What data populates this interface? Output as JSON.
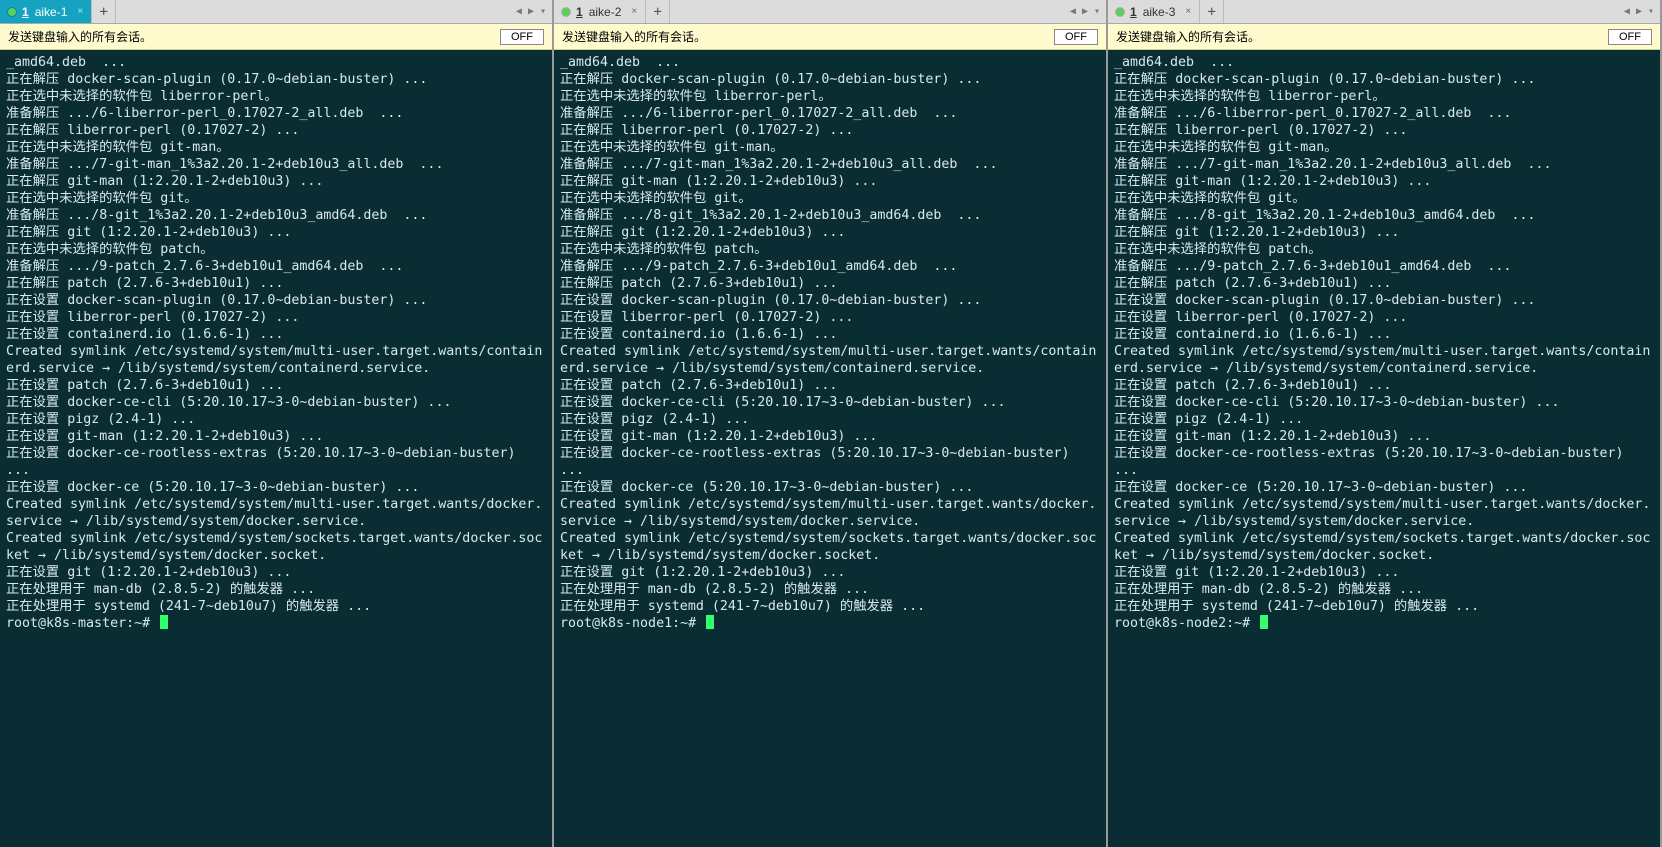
{
  "panes": [
    {
      "tab": {
        "index": "1",
        "title": "aike-1",
        "active": true
      },
      "infobar": {
        "message": "发送键盘输入的所有会话。",
        "button": "OFF"
      },
      "prompt": "root@k8s-master:~# ",
      "lines": [
        "_amd64.deb  ...",
        "正在解压 docker-scan-plugin (0.17.0~debian-buster) ...",
        "正在选中未选择的软件包 liberror-perl。",
        "准备解压 .../6-liberror-perl_0.17027-2_all.deb  ...",
        "正在解压 liberror-perl (0.17027-2) ...",
        "正在选中未选择的软件包 git-man。",
        "准备解压 .../7-git-man_1%3a2.20.1-2+deb10u3_all.deb  ...",
        "正在解压 git-man (1:2.20.1-2+deb10u3) ...",
        "正在选中未选择的软件包 git。",
        "准备解压 .../8-git_1%3a2.20.1-2+deb10u3_amd64.deb  ...",
        "正在解压 git (1:2.20.1-2+deb10u3) ...",
        "正在选中未选择的软件包 patch。",
        "准备解压 .../9-patch_2.7.6-3+deb10u1_amd64.deb  ...",
        "正在解压 patch (2.7.6-3+deb10u1) ...",
        "正在设置 docker-scan-plugin (0.17.0~debian-buster) ...",
        "正在设置 liberror-perl (0.17027-2) ...",
        "正在设置 containerd.io (1.6.6-1) ...",
        "Created symlink /etc/systemd/system/multi-user.target.wants/containerd.service → /lib/systemd/system/containerd.service.",
        "正在设置 patch (2.7.6-3+deb10u1) ...",
        "正在设置 docker-ce-cli (5:20.10.17~3-0~debian-buster) ...",
        "正在设置 pigz (2.4-1) ...",
        "正在设置 git-man (1:2.20.1-2+deb10u3) ...",
        "正在设置 docker-ce-rootless-extras (5:20.10.17~3-0~debian-buster) ...",
        "正在设置 docker-ce (5:20.10.17~3-0~debian-buster) ...",
        "Created symlink /etc/systemd/system/multi-user.target.wants/docker.service → /lib/systemd/system/docker.service.",
        "Created symlink /etc/systemd/system/sockets.target.wants/docker.socket → /lib/systemd/system/docker.socket.",
        "正在设置 git (1:2.20.1-2+deb10u3) ...",
        "正在处理用于 man-db (2.8.5-2) 的触发器 ...",
        "正在处理用于 systemd (241-7~deb10u7) 的触发器 ..."
      ]
    },
    {
      "tab": {
        "index": "1",
        "title": "aike-2",
        "active": false
      },
      "infobar": {
        "message": "发送键盘输入的所有会话。",
        "button": "OFF"
      },
      "prompt": "root@k8s-node1:~# ",
      "lines": [
        "_amd64.deb  ...",
        "正在解压 docker-scan-plugin (0.17.0~debian-buster) ...",
        "正在选中未选择的软件包 liberror-perl。",
        "准备解压 .../6-liberror-perl_0.17027-2_all.deb  ...",
        "正在解压 liberror-perl (0.17027-2) ...",
        "正在选中未选择的软件包 git-man。",
        "准备解压 .../7-git-man_1%3a2.20.1-2+deb10u3_all.deb  ...",
        "正在解压 git-man (1:2.20.1-2+deb10u3) ...",
        "正在选中未选择的软件包 git。",
        "准备解压 .../8-git_1%3a2.20.1-2+deb10u3_amd64.deb  ...",
        "正在解压 git (1:2.20.1-2+deb10u3) ...",
        "正在选中未选择的软件包 patch。",
        "准备解压 .../9-patch_2.7.6-3+deb10u1_amd64.deb  ...",
        "正在解压 patch (2.7.6-3+deb10u1) ...",
        "正在设置 docker-scan-plugin (0.17.0~debian-buster) ...",
        "正在设置 liberror-perl (0.17027-2) ...",
        "正在设置 containerd.io (1.6.6-1) ...",
        "Created symlink /etc/systemd/system/multi-user.target.wants/containerd.service → /lib/systemd/system/containerd.service.",
        "正在设置 patch (2.7.6-3+deb10u1) ...",
        "正在设置 docker-ce-cli (5:20.10.17~3-0~debian-buster) ...",
        "正在设置 pigz (2.4-1) ...",
        "正在设置 git-man (1:2.20.1-2+deb10u3) ...",
        "正在设置 docker-ce-rootless-extras (5:20.10.17~3-0~debian-buster) ...",
        "正在设置 docker-ce (5:20.10.17~3-0~debian-buster) ...",
        "Created symlink /etc/systemd/system/multi-user.target.wants/docker.service → /lib/systemd/system/docker.service.",
        "Created symlink /etc/systemd/system/sockets.target.wants/docker.socket → /lib/systemd/system/docker.socket.",
        "正在设置 git (1:2.20.1-2+deb10u3) ...",
        "正在处理用于 man-db (2.8.5-2) 的触发器 ...",
        "正在处理用于 systemd (241-7~deb10u7) 的触发器 ..."
      ]
    },
    {
      "tab": {
        "index": "1",
        "title": "aike-3",
        "active": false
      },
      "infobar": {
        "message": "发送键盘输入的所有会话。",
        "button": "OFF"
      },
      "prompt": "root@k8s-node2:~# ",
      "lines": [
        "_amd64.deb  ...",
        "正在解压 docker-scan-plugin (0.17.0~debian-buster) ...",
        "正在选中未选择的软件包 liberror-perl。",
        "准备解压 .../6-liberror-perl_0.17027-2_all.deb  ...",
        "正在解压 liberror-perl (0.17027-2) ...",
        "正在选中未选择的软件包 git-man。",
        "准备解压 .../7-git-man_1%3a2.20.1-2+deb10u3_all.deb  ...",
        "正在解压 git-man (1:2.20.1-2+deb10u3) ...",
        "正在选中未选择的软件包 git。",
        "准备解压 .../8-git_1%3a2.20.1-2+deb10u3_amd64.deb  ...",
        "正在解压 git (1:2.20.1-2+deb10u3) ...",
        "正在选中未选择的软件包 patch。",
        "准备解压 .../9-patch_2.7.6-3+deb10u1_amd64.deb  ...",
        "正在解压 patch (2.7.6-3+deb10u1) ...",
        "正在设置 docker-scan-plugin (0.17.0~debian-buster) ...",
        "正在设置 liberror-perl (0.17027-2) ...",
        "正在设置 containerd.io (1.6.6-1) ...",
        "Created symlink /etc/systemd/system/multi-user.target.wants/containerd.service → /lib/systemd/system/containerd.service.",
        "正在设置 patch (2.7.6-3+deb10u1) ...",
        "正在设置 docker-ce-cli (5:20.10.17~3-0~debian-buster) ...",
        "正在设置 pigz (2.4-1) ...",
        "正在设置 git-man (1:2.20.1-2+deb10u3) ...",
        "正在设置 docker-ce-rootless-extras (5:20.10.17~3-0~debian-buster) ...",
        "正在设置 docker-ce (5:20.10.17~3-0~debian-buster) ...",
        "Created symlink /etc/systemd/system/multi-user.target.wants/docker.service → /lib/systemd/system/docker.service.",
        "Created symlink /etc/systemd/system/sockets.target.wants/docker.socket → /lib/systemd/system/docker.socket.",
        "正在设置 git (1:2.20.1-2+deb10u3) ...",
        "正在处理用于 man-db (2.8.5-2) 的触发器 ...",
        "正在处理用于 systemd (241-7~deb10u7) 的触发器 ..."
      ]
    }
  ],
  "icons": {
    "add": "+",
    "close": "×",
    "left": "◀",
    "right": "▶",
    "menu": "▾"
  }
}
